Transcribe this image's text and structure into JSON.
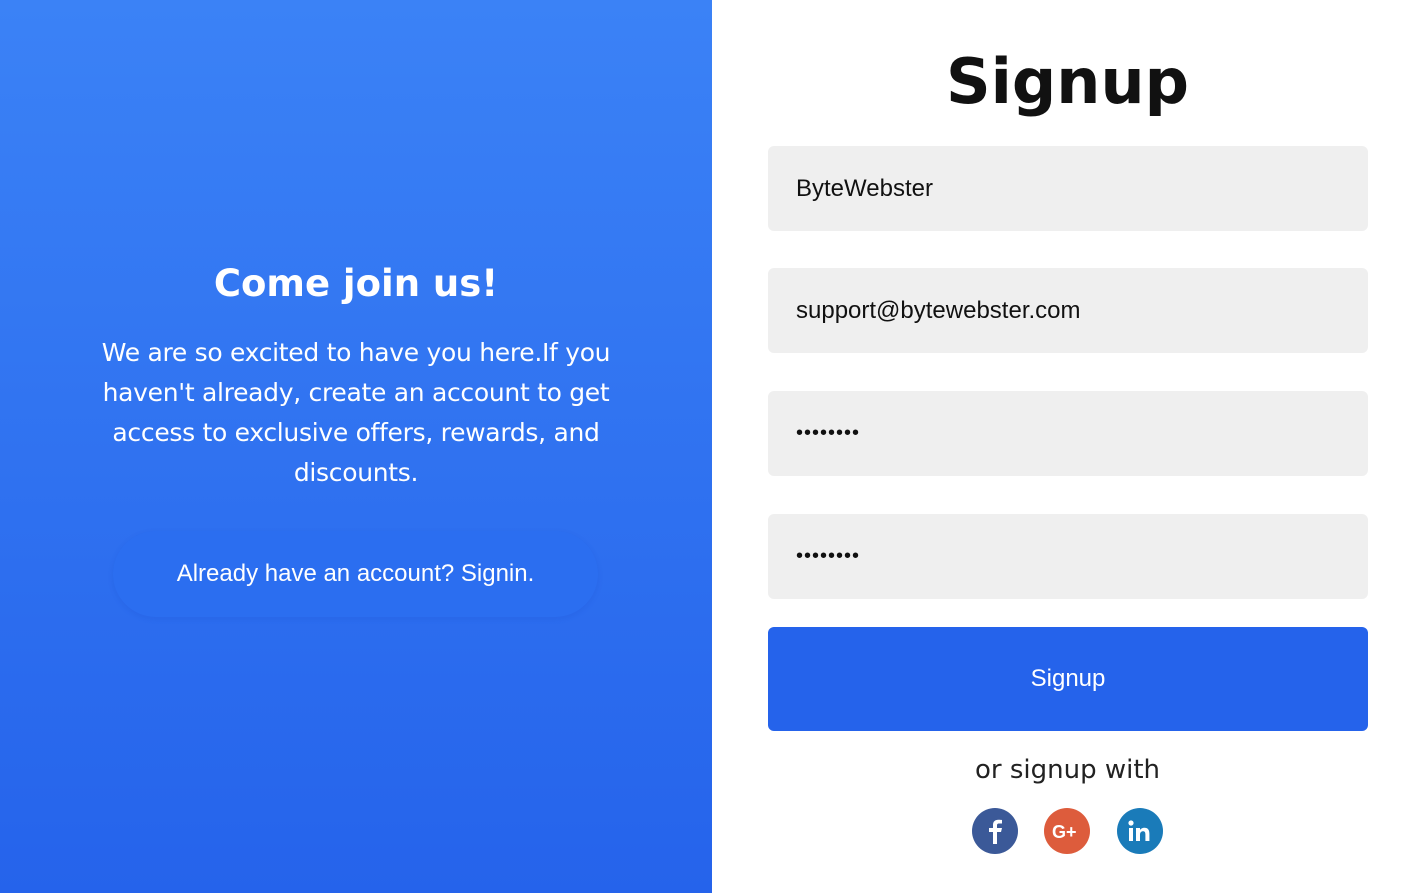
{
  "left_panel": {
    "title": "Come join us!",
    "description": "We are so excited to have you here.If you haven't already, create an account to get access to exclusive offers, rewards, and discounts.",
    "signin_link": "Already have an account? Signin.",
    "gradient_top": "#3b82f6",
    "gradient_bottom": "#2563eb"
  },
  "form": {
    "title": "Signup",
    "username_value": "ByteWebster",
    "email_value": "support@bytewebster.com",
    "password_value": "••••••••",
    "confirm_password_value": "••••••••",
    "submit_label": "Signup",
    "alt_text": "or signup with",
    "accent_color": "#2563eb"
  },
  "social": [
    {
      "name": "facebook-icon",
      "color": "#3b5998",
      "glyph": "f"
    },
    {
      "name": "google-plus-icon",
      "color": "#dd5c3c",
      "glyph": "G+"
    },
    {
      "name": "linkedin-icon",
      "color": "#1a7bb9",
      "glyph": "in"
    }
  ]
}
